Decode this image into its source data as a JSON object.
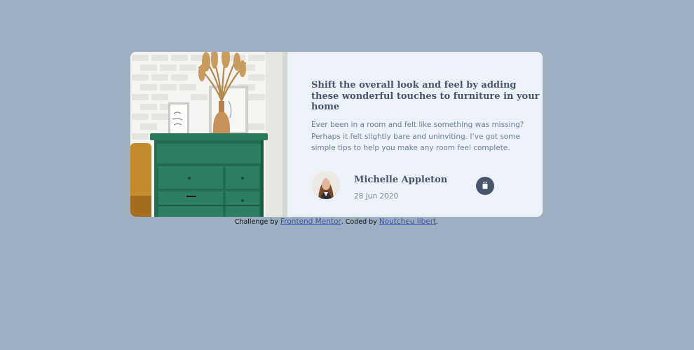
{
  "article": {
    "title": "Shift the overall look and feel by adding these wonderful touches to furniture in your home",
    "description": "Ever been in a room and felt like something was missing? Perhaps it felt slightly bare and uninviting. I’ve got some simple tips to help you make any room feel complete.",
    "image_icon": "drawers-photo",
    "author": {
      "name": "Michelle Appleton",
      "date": "28 Jun 2020",
      "avatar_icon": "avatar-photo"
    },
    "share_icon": "share-icon"
  },
  "attribution": {
    "prefix": "Challenge by ",
    "challenge_link": "Frontend Mentor",
    "middle": ". Coded by ",
    "author_link": "Noutcheu libert",
    "suffix": "."
  },
  "colors": {
    "background": "#9eafc2",
    "card": "#ecf2f8",
    "heading": "#48556a",
    "body_text": "#6e8098",
    "link": "#3e52a3"
  }
}
